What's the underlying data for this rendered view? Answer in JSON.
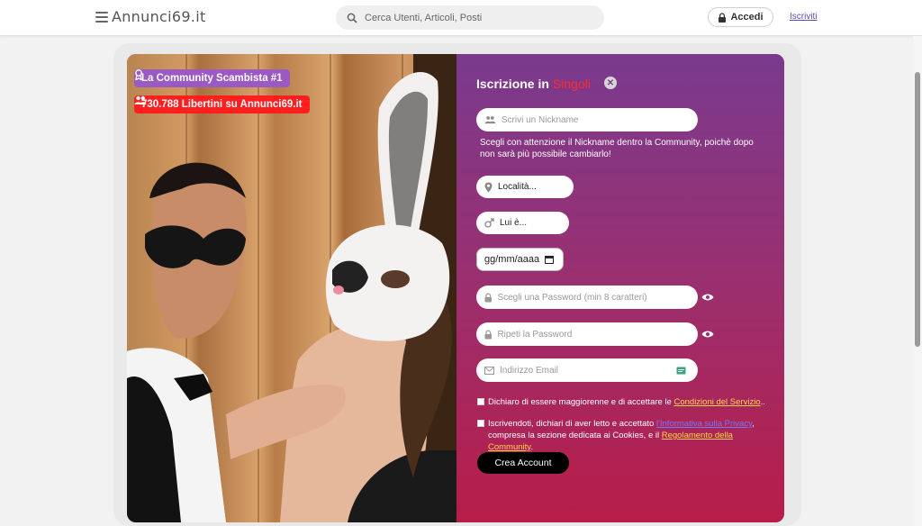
{
  "header": {
    "logo": "Annunci69.it",
    "search_placeholder": "Cerca Utenti, Articoli, Posti",
    "login_label": "Accedi",
    "signup_label": "Iscriviti"
  },
  "hero": {
    "badge_rank": "La Community Scambista #1",
    "badge_members": "730.788 Libertini su Annunci69.it"
  },
  "form": {
    "title": "Iscrizione in",
    "title_accent": "Singoli",
    "nickname_placeholder": "Scrivi un Nickname",
    "nickname_hint": "Scegli con attenzione il Nickname dentro la Community, poichè dopo non sarà più possibile cambiarlo!",
    "location_value": "Località...",
    "gender_value": "Lui è...",
    "birthdate_placeholder": "gg/mm/aaaa",
    "password_placeholder": "Scegli una Password (min 8 caratteri)",
    "password_repeat_placeholder": "Ripeti la Password",
    "email_placeholder": "Indirizzo Email",
    "terms_text": "Dichiaro di essere maggiorenne e di accettare le",
    "terms_link": "Condizioni del Servizio",
    "terms_end": "..",
    "privacy_text": "Iscrivendoti, dichiari di aver letto e accettato",
    "privacy_link": "l'Informativa sulla Privacy",
    "privacy_mid": ", compresa la sezione dedicata ai Cookies, e il",
    "rules_link": "Regolamento della Community",
    "rules_end": ".",
    "submit_label": "Crea Account"
  },
  "colors": {
    "accent_red": "#ff2a2a",
    "badge_purple": "#9b59c4",
    "badge_red": "#ff1f1f",
    "gradient_top": "#7a3a8e",
    "gradient_bottom": "#b81d48"
  }
}
